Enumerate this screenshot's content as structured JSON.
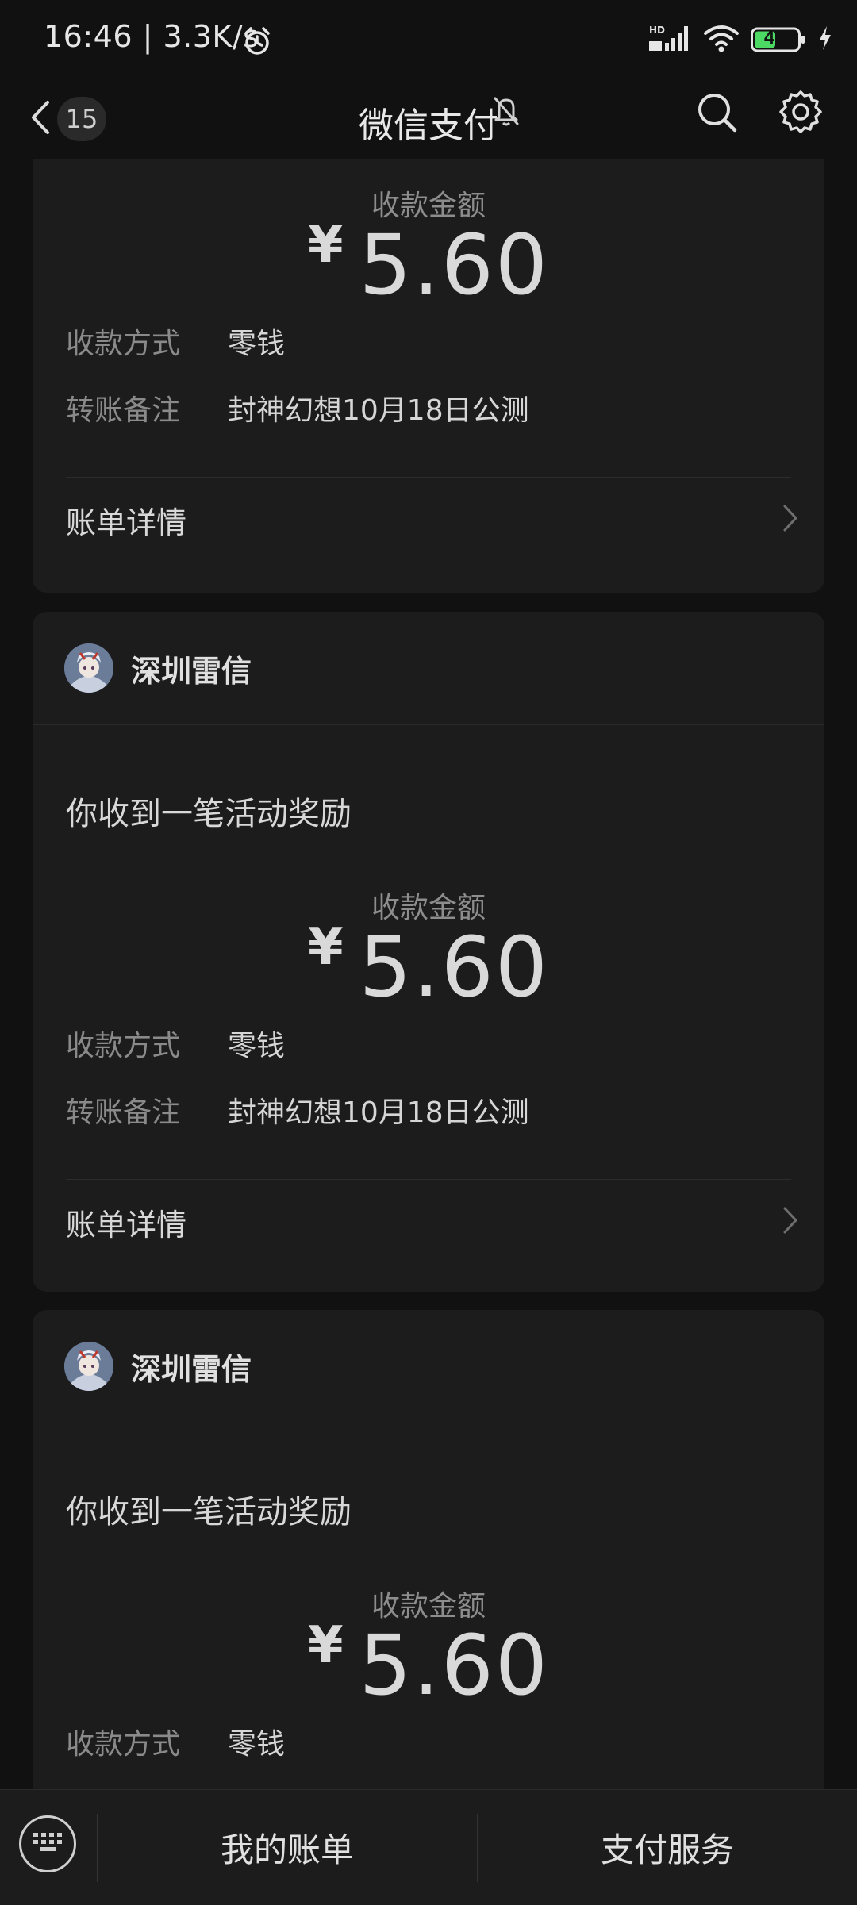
{
  "status_bar": {
    "time": "16:46 | 3.3K/s",
    "battery": "47",
    "icons": [
      "alarm-icon",
      "hd-signal-icon",
      "wifi-icon",
      "battery-icon",
      "charging-icon"
    ]
  },
  "nav": {
    "unread_count": "15",
    "title": "微信支付",
    "icons": [
      "back-chevron-icon",
      "bell-muted-icon",
      "search-icon",
      "gear-icon"
    ]
  },
  "cards": [
    {
      "amount_label": "收款金额",
      "currency": "¥",
      "amount": "5.60",
      "method_label": "收款方式",
      "method_value": "零钱",
      "note_label": "转账备注",
      "note_value": "封神幻想10月18日公测",
      "detail_label": "账单详情"
    },
    {
      "merchant": "深圳雷信",
      "title": "你收到一笔活动奖励",
      "amount_label": "收款金额",
      "currency": "¥",
      "amount": "5.60",
      "method_label": "收款方式",
      "method_value": "零钱",
      "note_label": "转账备注",
      "note_value": "封神幻想10月18日公测",
      "detail_label": "账单详情"
    },
    {
      "merchant": "深圳雷信",
      "title": "你收到一笔活动奖励",
      "amount_label": "收款金额",
      "currency": "¥",
      "amount": "5.60",
      "method_label": "收款方式",
      "method_value": "零钱"
    }
  ],
  "bottom_bar": {
    "tab_bills": "我的账单",
    "tab_services": "支付服务",
    "icons": [
      "keyboard-icon"
    ]
  },
  "colors": {
    "background": "#111111",
    "card": "#1c1c1c",
    "text_primary": "#d9d9d9",
    "text_secondary": "#8a8a8a",
    "battery_green": "#4cd964"
  }
}
